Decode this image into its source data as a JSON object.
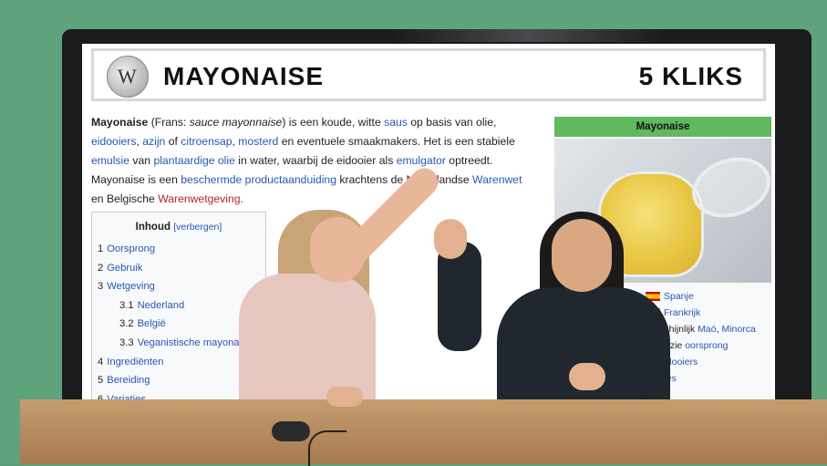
{
  "header": {
    "title": "MAYONAISE",
    "clicks": "5 KLIKS",
    "logo_glyph": "W"
  },
  "article": {
    "p1_bold": "Mayonaise",
    "p1_a": " (Frans: ",
    "p1_italic": "sauce mayonnaise",
    "p1_b": ") is een koude, witte ",
    "link_saus": "saus",
    "p1_c": " op basis van olie,",
    "link_eidooiers": "eidooiers",
    "sep1": ", ",
    "link_azijn": "azijn",
    "p1_d": " of ",
    "link_citroensap": "citroensap",
    "sep2": ", ",
    "link_mosterd": "mosterd",
    "p1_e": " en eventuele smaakmakers. Het is een stabiele",
    "link_emulsie": "emulsie",
    "p1_f": " van ",
    "link_plantaardige_olie": "plantaardige olie",
    "p1_g": " in water, waarbij de eidooier als ",
    "link_emulgator": "emulgator",
    "p1_h": " optreedt.",
    "p1_i": "Mayonaise is een ",
    "link_beschermde": "beschermde productaanduiding",
    "p1_j": " krachtens de Nederlandse ",
    "link_warenwet": "Warenwet",
    "p1_k": "en Belgische ",
    "link_warenwetgeving": "Warenwetgeving",
    "p1_l": "."
  },
  "toc": {
    "title": "Inhoud",
    "hide": "[verbergen]",
    "items": [
      {
        "n": "1",
        "t": "Oorsprong"
      },
      {
        "n": "2",
        "t": "Gebruik"
      },
      {
        "n": "3",
        "t": "Wetgeving"
      },
      {
        "n": "3.1",
        "t": "Nederland"
      },
      {
        "n": "3.2",
        "t": "België"
      },
      {
        "n": "3.3",
        "t": "Veganistische mayonaise"
      },
      {
        "n": "4",
        "t": "Ingrediënten"
      },
      {
        "n": "5",
        "t": "Bereiding"
      },
      {
        "n": "6",
        "t": "Variaties"
      }
    ]
  },
  "infobox": {
    "title": "Mayonaise",
    "rows": [
      "Spanje",
      "Frankrijk",
      "aarschijnlijk ",
      "Maó",
      ", ",
      "Minorca",
      "twist, zie ",
      "oorsprong",
      "en ",
      "eidooiers",
      "ariaties"
    ]
  }
}
